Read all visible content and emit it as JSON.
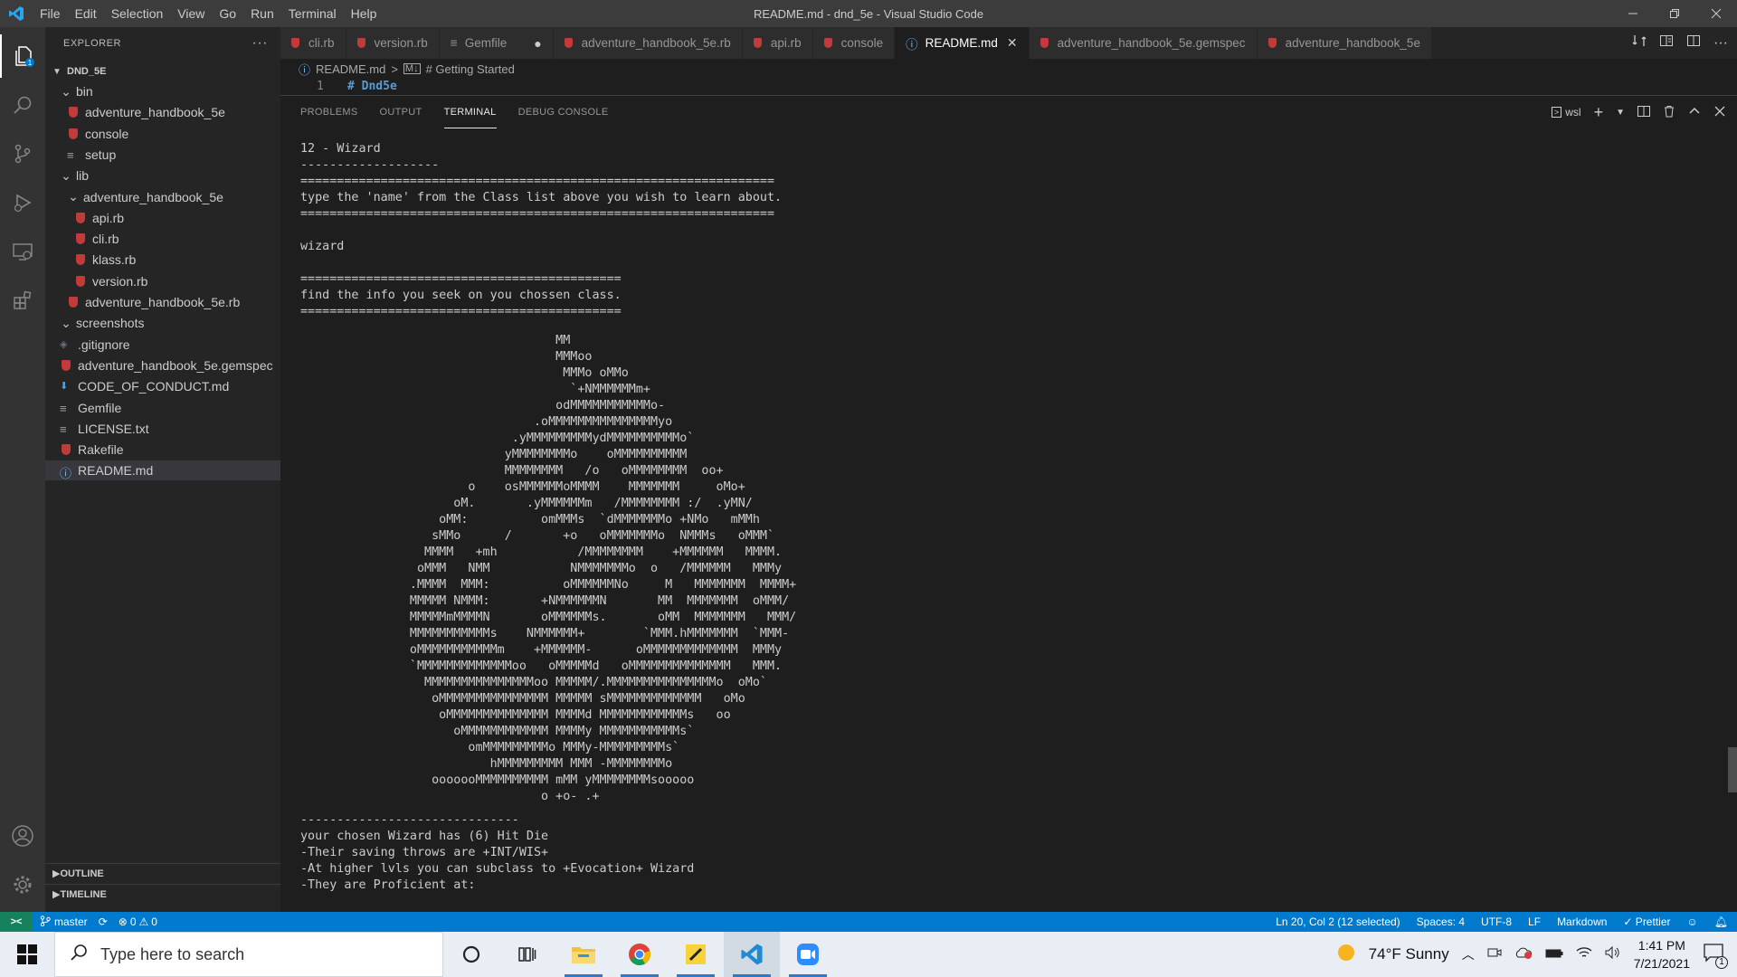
{
  "window": {
    "title": "README.md - dnd_5e - Visual Studio Code",
    "menu": [
      "File",
      "Edit",
      "Selection",
      "View",
      "Go",
      "Run",
      "Terminal",
      "Help"
    ]
  },
  "sidebar": {
    "title": "EXPLORER",
    "more": "···",
    "root": "DND_5E",
    "tree": [
      {
        "label": "bin",
        "type": "folder",
        "depth": 1,
        "open": true
      },
      {
        "label": "adventure_handbook_5e",
        "type": "ruby",
        "depth": 2
      },
      {
        "label": "console",
        "type": "ruby",
        "depth": 2
      },
      {
        "label": "setup",
        "type": "text",
        "depth": 2
      },
      {
        "label": "lib",
        "type": "folder",
        "depth": 1,
        "open": true
      },
      {
        "label": "adventure_handbook_5e",
        "type": "folder",
        "depth": 2,
        "open": true
      },
      {
        "label": "api.rb",
        "type": "ruby",
        "depth": 3
      },
      {
        "label": "cli.rb",
        "type": "ruby",
        "depth": 3
      },
      {
        "label": "klass.rb",
        "type": "ruby",
        "depth": 3
      },
      {
        "label": "version.rb",
        "type": "ruby",
        "depth": 3
      },
      {
        "label": "adventure_handbook_5e.rb",
        "type": "ruby",
        "depth": 2
      },
      {
        "label": "screenshots",
        "type": "folder",
        "depth": 1,
        "open": true
      },
      {
        "label": ".gitignore",
        "type": "git",
        "depth": 1
      },
      {
        "label": "adventure_handbook_5e.gemspec",
        "type": "ruby",
        "depth": 1
      },
      {
        "label": "CODE_OF_CONDUCT.md",
        "type": "md",
        "depth": 1
      },
      {
        "label": "Gemfile",
        "type": "text",
        "depth": 1
      },
      {
        "label": "LICENSE.txt",
        "type": "text",
        "depth": 1
      },
      {
        "label": "Rakefile",
        "type": "ruby",
        "depth": 1
      },
      {
        "label": "README.md",
        "type": "info",
        "depth": 1,
        "selected": true
      }
    ],
    "outline": "OUTLINE",
    "timeline": "TIMELINE"
  },
  "tabs": [
    {
      "label": "cli.rb",
      "icon": "ruby"
    },
    {
      "label": "version.rb",
      "icon": "ruby"
    },
    {
      "label": "Gemfile",
      "icon": "text",
      "dirty": "●"
    },
    {
      "label": "adventure_handbook_5e.rb",
      "icon": "ruby"
    },
    {
      "label": "api.rb",
      "icon": "ruby"
    },
    {
      "label": "console",
      "icon": "ruby"
    },
    {
      "label": "README.md",
      "icon": "info",
      "active": true,
      "close": "✕"
    },
    {
      "label": "adventure_handbook_5e.gemspec",
      "icon": "ruby"
    },
    {
      "label": "adventure_handbook_5e",
      "icon": "ruby"
    }
  ],
  "breadcrumb": {
    "file": "README.md",
    "sep": ">",
    "section": "# Getting Started"
  },
  "editor": {
    "line_number": "1",
    "code": "# Dnd5e"
  },
  "panel": {
    "tabs": [
      "PROBLEMS",
      "OUTPUT",
      "TERMINAL",
      "DEBUG CONSOLE"
    ],
    "active_tab": "TERMINAL",
    "shell": "wsl",
    "terminal_top": "12 - Wizard\n-------------------\n=================================================================\ntype the 'name' from the Class list above you wish to learn about.\n=================================================================\n\nwizard\n\n============================================\nfind the info you seek on you chossen class.\n============================================",
    "ascii_art": "                                   MM\n                                   MMMoo\n                                    MMMo oMMo\n                                     `+NMMMMMMm+\n                                   odMMMMMMMMMMMo-\n                                .oMMMMMMMMMMMMMMMyo\n                             .yMMMMMMMMMydMMMMMMMMMMo`\n                            yMMMMMMMMo    oMMMMMMMMMM\n                            MMMMMMMM   /o   oMMMMMMMM  oo+\n                       o    osMMMMMMoMMMM    MMMMMMM     oMo+\n                     oM.       .yMMMMMMm   /MMMMMMMM :/  .yMN/\n                   oMM:          omMMMs  `dMMMMMMMo +NMo   mMMh\n                  sMMo      /       +o   oMMMMMMMo  NMMMs   oMMM`\n                 MMMM   +mh           /MMMMMMMM    +MMMMMM   MMMM.\n                oMMM   NMM           NMMMMMMMo  o   /MMMMMM   MMMy\n               .MMMM  MMM:          oMMMMMMNo     M   MMMMMMM  MMMM+\n               MMMMM NMMM:       +NMMMMMMN       MM  MMMMMMM  oMMM/\n               MMMMMmMMMMN       oMMMMMMs.       oMM  MMMMMMM   MMM/\n               MMMMMMMMMMMs    NMMMMMM+        `MMM.hMMMMMMM  `MMM-\n               oMMMMMMMMMMMm    +MMMMMM-      oMMMMMMMMMMMMM  MMMy\n               `MMMMMMMMMMMMMoo   oMMMMMd   oMMMMMMMMMMMMMM   MMM.\n                 MMMMMMMMMMMMMMMoo MMMMM/.MMMMMMMMMMMMMMMo  oMo`\n                  oMMMMMMMMMMMMMMM MMMMM sMMMMMMMMMMMMM   oMo\n                   oMMMMMMMMMMMMMM MMMMd MMMMMMMMMMMMs   oo\n                     oMMMMMMMMMMMM MMMMy MMMMMMMMMMMs`\n                       omMMMMMMMMMo MMMy-MMMMMMMMMs`\n                          hMMMMMMMMM MMM -MMMMMMMMo\n                  ooooooMMMMMMMMMM mMM yMMMMMMMMsooooo\n                                 o +o- .+",
    "terminal_bottom": "------------------------------\nyour chosen Wizard has (6) Hit Die\n-Their saving throws are +INT/WIS+\n-At higher lvls you can subclass to +Evocation+ Wizard\n-They are Proficient at:"
  },
  "statusbar": {
    "remote": "><",
    "branch": "master",
    "errors": "0",
    "warnings": "0",
    "position": "Ln 20, Col 2 (12 selected)",
    "spaces": "Spaces: 4",
    "encoding": "UTF-8",
    "eol": "LF",
    "language": "Markdown",
    "prettier": "✓ Prettier"
  },
  "taskbar": {
    "search_placeholder": "Type here to search",
    "weather": "74°F  Sunny",
    "time": "1:41 PM",
    "date": "7/21/2021",
    "notifications": "1"
  },
  "colors": {
    "accent": "#007acc",
    "ruby": "#c23b3b",
    "remote": "#16825d"
  }
}
